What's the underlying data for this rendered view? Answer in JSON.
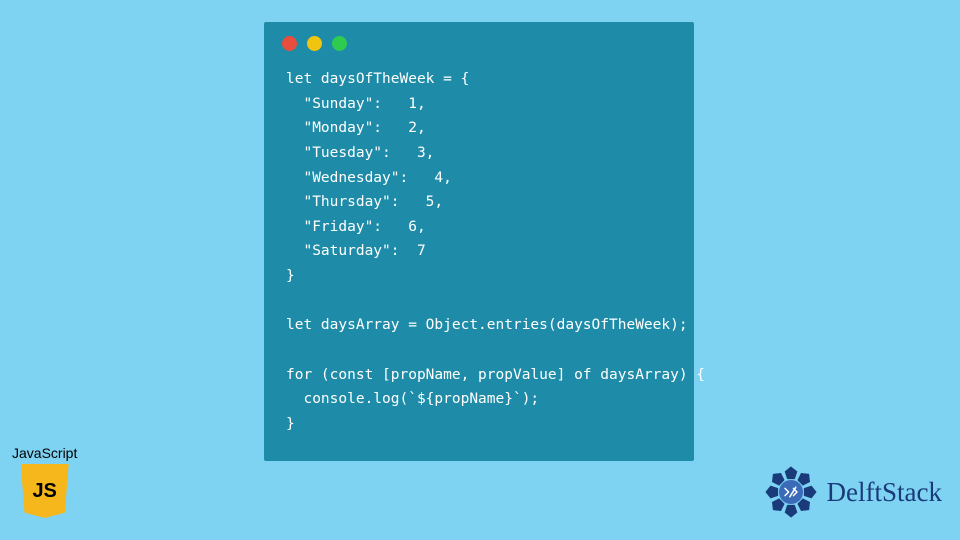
{
  "code": {
    "lines": [
      "let daysOfTheWeek = {",
      "  \"Sunday\":   1,",
      "  \"Monday\":   2,",
      "  \"Tuesday\":   3,",
      "  \"Wednesday\":   4,",
      "  \"Thursday\":   5,",
      "  \"Friday\":   6,",
      "  \"Saturday\":  7",
      "}",
      "",
      "let daysArray = Object.entries(daysOfTheWeek);",
      "",
      "for (const [propName, propValue] of daysArray) {",
      "  console.log(`${propName}`);",
      "}"
    ]
  },
  "jsLabel": "JavaScript",
  "jsIconText": "JS",
  "delftText": "DelftStack",
  "colors": {
    "pageBg": "#7ed3f2",
    "windowBg": "#1e8ca8",
    "dotRed": "#e84e3b",
    "dotYellow": "#f1c40f",
    "dotGreen": "#2fcb4e",
    "jsShield": "#f5b71b",
    "delftBlue": "#1a3b7a"
  }
}
